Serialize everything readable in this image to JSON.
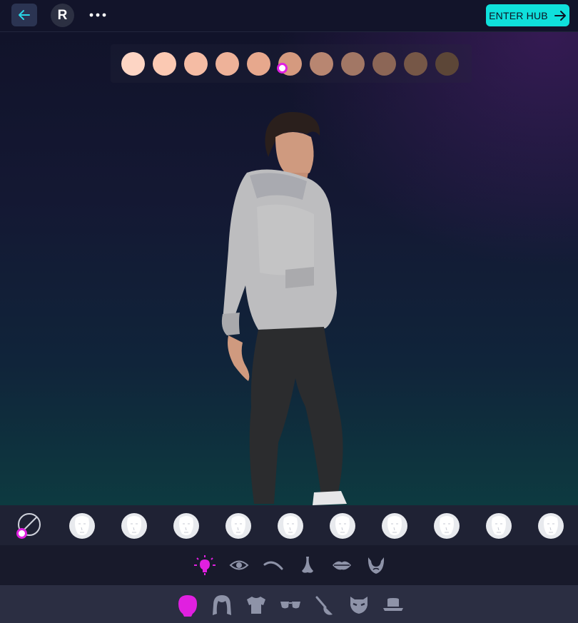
{
  "topbar": {
    "avatar_initial": "R",
    "enter_label": "ENTER HUB",
    "icons": [
      "back-arrow-icon",
      "more-dots-icon",
      "arrow-right-icon"
    ]
  },
  "skin_tones": {
    "colors": [
      "#fdd5c4",
      "#fbc9b3",
      "#f5bca4",
      "#eeb299",
      "#e7a88d",
      "#d59a7f",
      "#b88671",
      "#a27765",
      "#8c6656",
      "#765747",
      "#5c4637"
    ],
    "selected_index": 5
  },
  "colors": {
    "accent_cyan": "#0fe0dc",
    "selected_magenta": "#e020e0",
    "face_option": "#e8eaee"
  },
  "face_options": {
    "count": 10,
    "selected": "none"
  },
  "face_categories": {
    "icons": [
      "sparkle-head-icon",
      "eye-icon",
      "eyebrow-icon",
      "nose-icon",
      "lips-icon",
      "beard-icon"
    ],
    "active": "sparkle-head-icon"
  },
  "main_tabs": {
    "icons": [
      "head-icon",
      "hair-icon",
      "shirt-icon",
      "glasses-icon",
      "brush-icon",
      "mask-icon",
      "hat-icon"
    ],
    "active": "head-icon"
  }
}
